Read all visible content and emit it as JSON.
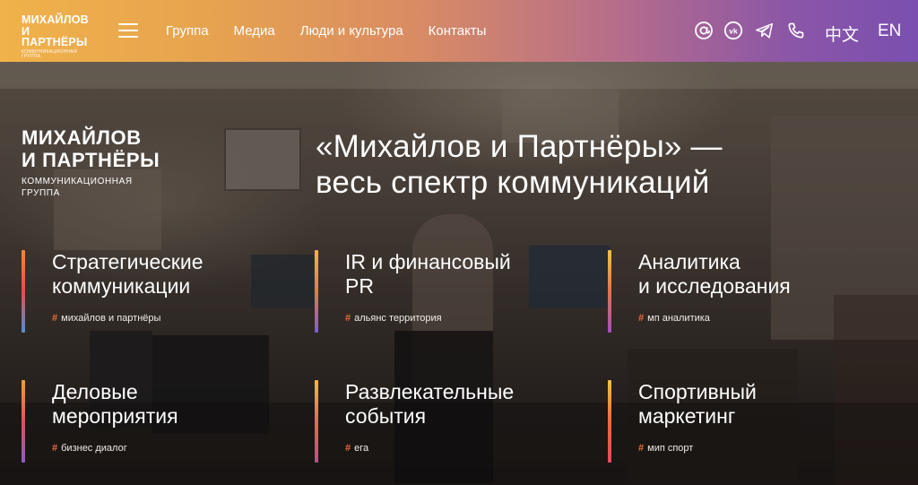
{
  "header": {
    "logo": {
      "line1": "МИХАЙЛОВ",
      "line2": "И ПАРТНЁРЫ",
      "line3": "КОММУНИКАЦИОННАЯ ГРУППА"
    },
    "nav": [
      "Группа",
      "Медиа",
      "Люди и культура",
      "Контакты"
    ],
    "icons": [
      "email-icon",
      "vk-icon",
      "telegram-icon",
      "phone-icon"
    ],
    "languages": [
      "中文",
      "EN"
    ]
  },
  "hero": {
    "logo": {
      "line1": "МИХАЙЛОВ",
      "line2": "И ПАРТНЁРЫ",
      "line3": "КОММУНИКАЦИОННАЯ ГРУППА"
    },
    "tagline_line1": "«Михайлов и Партнёры» —",
    "tagline_line2": "весь спектр коммуникаций",
    "cards": [
      {
        "title_line1": "Стратегические",
        "title_line2": "коммуникации",
        "tag": "михайлов и партнёры"
      },
      {
        "title_line1": "IR и финансовый",
        "title_line2": "PR",
        "tag": "альянс территория"
      },
      {
        "title_line1": "Аналитика",
        "title_line2": "и исследования",
        "tag": "мп аналитика"
      },
      {
        "title_line1": "Деловые",
        "title_line2": "мероприятия",
        "tag": "бизнес диалог"
      },
      {
        "title_line1": "Развлекательные",
        "title_line2": "события",
        "tag": "ега"
      },
      {
        "title_line1": "Спортивный",
        "title_line2": "маркетинг",
        "tag": "мип спорт"
      }
    ],
    "hash_symbol": "#"
  },
  "colors": {
    "header_gradient_start": "#f0b24a",
    "header_gradient_end": "#7a4fb0",
    "hash_accent": "#ee6a3c",
    "bar_1": [
      "#f08a35",
      "#e64c4c",
      "#4f8fd9"
    ],
    "bar_2": [
      "#f3b43c",
      "#e07a4a",
      "#7a5fd0"
    ],
    "bar_3": [
      "#f6c244",
      "#e4734a",
      "#a44fbf"
    ],
    "bar_4": [
      "#f0a03a",
      "#d9545a",
      "#8e5ac6"
    ],
    "bar_5": [
      "#f5b83f",
      "#e46a4c",
      "#c24a86"
    ],
    "bar_6": [
      "#f6c144",
      "#ee6a3c",
      "#e24d5a"
    ]
  }
}
